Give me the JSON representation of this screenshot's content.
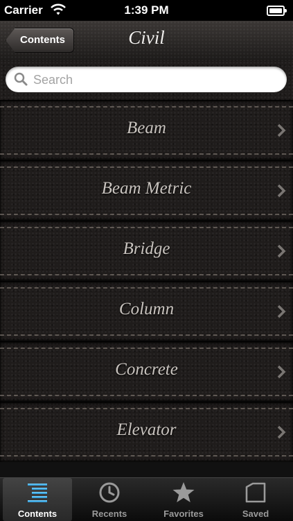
{
  "status_bar": {
    "carrier": "Carrier",
    "time": "1:39 PM"
  },
  "nav": {
    "back_label": "Contents",
    "title": "Civil"
  },
  "search": {
    "placeholder": "Search"
  },
  "list": {
    "items": [
      {
        "label": "Beam"
      },
      {
        "label": "Beam Metric"
      },
      {
        "label": "Bridge"
      },
      {
        "label": "Column"
      },
      {
        "label": "Concrete"
      },
      {
        "label": "Elevator"
      }
    ]
  },
  "tabs": [
    {
      "label": "Contents",
      "icon": "contents-list-icon",
      "selected": true
    },
    {
      "label": "Recents",
      "icon": "clock-icon"
    },
    {
      "label": "Favorites",
      "icon": "star-icon"
    },
    {
      "label": "Saved",
      "icon": "folder-icon"
    }
  ],
  "colors": {
    "accent": "#3ab0e0",
    "row_text": "#c9c4bf"
  }
}
